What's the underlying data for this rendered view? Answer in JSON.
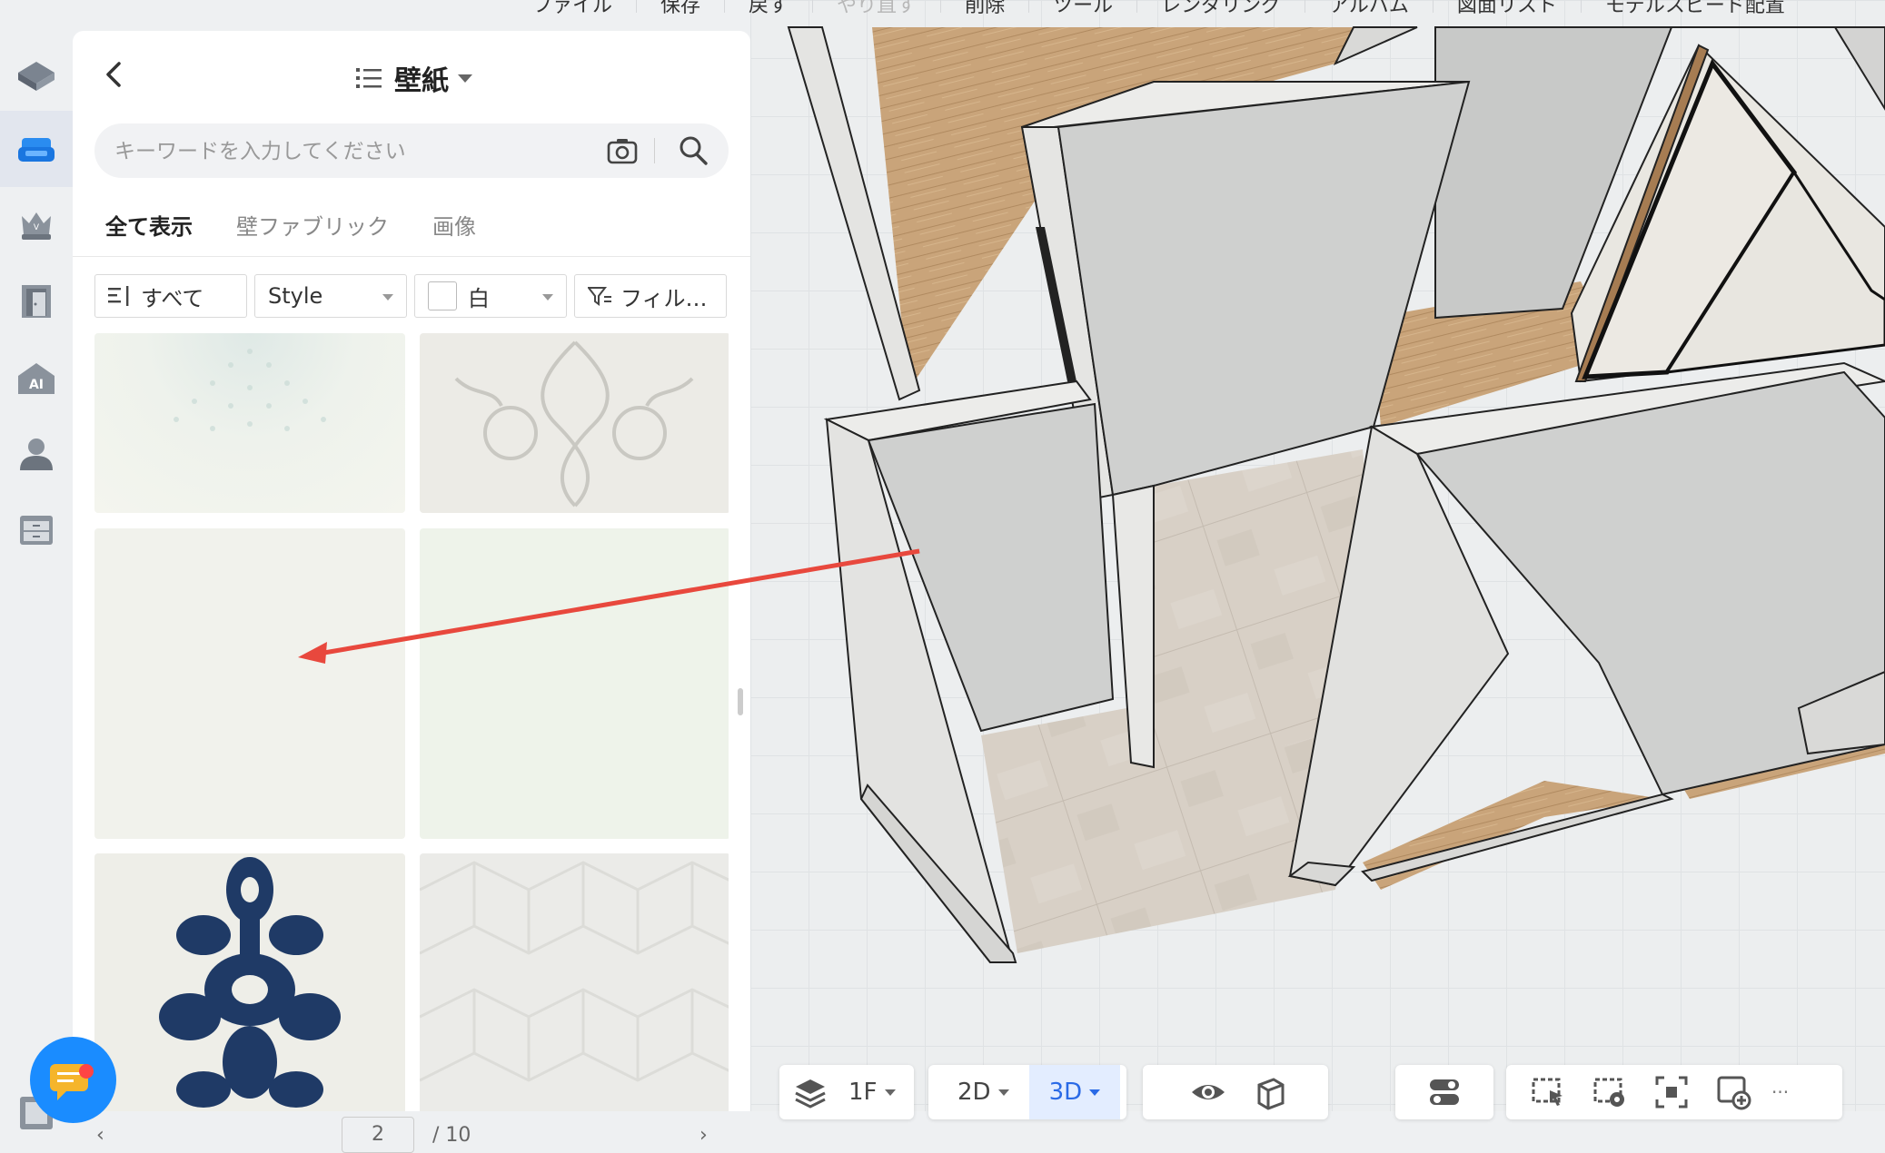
{
  "top_menu": {
    "items": [
      {
        "label": "ファイル",
        "enabled": true
      },
      {
        "label": "保存",
        "enabled": true
      },
      {
        "label": "戻す",
        "enabled": true
      },
      {
        "label": "やり直す",
        "enabled": false
      },
      {
        "label": "削除",
        "enabled": true
      },
      {
        "label": "ツール",
        "enabled": true
      },
      {
        "label": "レンダリング",
        "enabled": true
      },
      {
        "label": "アルバム",
        "enabled": true
      },
      {
        "label": "図面リスト",
        "enabled": true
      },
      {
        "label": "モデルスピード配置",
        "enabled": true
      }
    ]
  },
  "rail": {
    "items": [
      {
        "icon": "floorplan-icon",
        "active": false
      },
      {
        "icon": "sofa-icon",
        "active": true
      },
      {
        "icon": "crown-icon",
        "active": false
      },
      {
        "icon": "door-icon",
        "active": false
      },
      {
        "icon": "ai-home-icon",
        "active": false
      },
      {
        "icon": "user-icon",
        "active": false
      },
      {
        "icon": "cabinet-icon",
        "active": false
      }
    ]
  },
  "panel": {
    "title": "壁紙",
    "search": {
      "placeholder": "キーワードを入力してください",
      "value": ""
    },
    "tabs": [
      {
        "label": "全て表示",
        "active": true
      },
      {
        "label": "壁ファブリック",
        "active": false
      },
      {
        "label": "画像",
        "active": false
      }
    ],
    "filters": {
      "category": "すべて",
      "style": "Style",
      "color": "白",
      "filter": "フィル…"
    },
    "pager": {
      "current": "2",
      "total": "/ 10"
    }
  },
  "toolbar": {
    "floor": "1F",
    "view_2d": "2D",
    "view_3d": "3D",
    "more": "···"
  },
  "colors": {
    "accent": "#2a6ae6",
    "fab": "#1a8cff",
    "arrow": "#e8483d",
    "damask_navy": "#1f3a66"
  }
}
